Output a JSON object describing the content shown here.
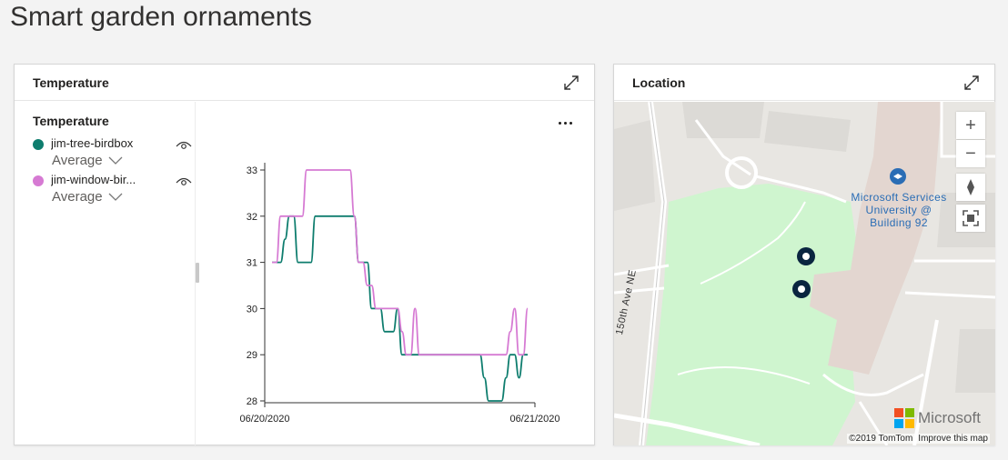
{
  "page": {
    "title": "Smart garden ornaments"
  },
  "temperature_tile": {
    "title": "Temperature",
    "legend": {
      "title": "Temperature",
      "items": [
        {
          "name": "jim-tree-birdbox",
          "aggregation": "Average",
          "color": "#0e7d6e"
        },
        {
          "name": "jim-window-bir...",
          "aggregation": "Average",
          "color": "#d67ad3"
        }
      ]
    }
  },
  "location_tile": {
    "title": "Location",
    "poi_label": [
      "Microsoft Services",
      "University @",
      "Building 92"
    ],
    "road_label": "150th Ave NE",
    "controls": [
      "zoom-in",
      "zoom-out",
      "compass",
      "fullscreen"
    ],
    "brand": "Microsoft",
    "copyright": "©2019 TomTom",
    "improve_link": "Improve this map"
  },
  "chart_data": {
    "type": "line",
    "x_labels": [
      "06/20/2020",
      "06/21/2020"
    ],
    "ylim": [
      28,
      33
    ],
    "yticks": [
      28,
      29,
      30,
      31,
      32,
      33
    ],
    "series": [
      {
        "name": "jim-tree-birdbox",
        "color": "#0e7d6e",
        "values": [
          31,
          31,
          31,
          31.5,
          32,
          32,
          31,
          31,
          31,
          31,
          32,
          32,
          32,
          32,
          32,
          32,
          32,
          32,
          32,
          32,
          31,
          31,
          31,
          30,
          30,
          30,
          29.5,
          29.5,
          29.5,
          30,
          29,
          29,
          29,
          29,
          29,
          29,
          29,
          29,
          29,
          29,
          29,
          29,
          29,
          29,
          29,
          29,
          29,
          29,
          29,
          28.5,
          28,
          28,
          28,
          28,
          28.5,
          29,
          29,
          28.5,
          29,
          29
        ]
      },
      {
        "name": "jim-window-bir...",
        "color": "#d67ad3",
        "values": [
          31,
          31,
          32,
          32,
          32,
          32,
          32,
          32,
          33,
          33,
          33,
          33,
          33,
          33,
          33,
          33,
          33,
          33,
          33,
          32,
          31,
          31,
          30.5,
          30.5,
          30,
          30,
          30,
          30,
          30,
          30,
          29.5,
          29,
          29,
          30,
          29,
          29,
          29,
          29,
          29,
          29,
          29,
          29,
          29,
          29,
          29,
          29,
          29,
          29,
          29,
          29,
          29,
          29,
          29,
          29,
          29,
          29.5,
          30,
          29,
          29,
          30
        ]
      }
    ]
  }
}
